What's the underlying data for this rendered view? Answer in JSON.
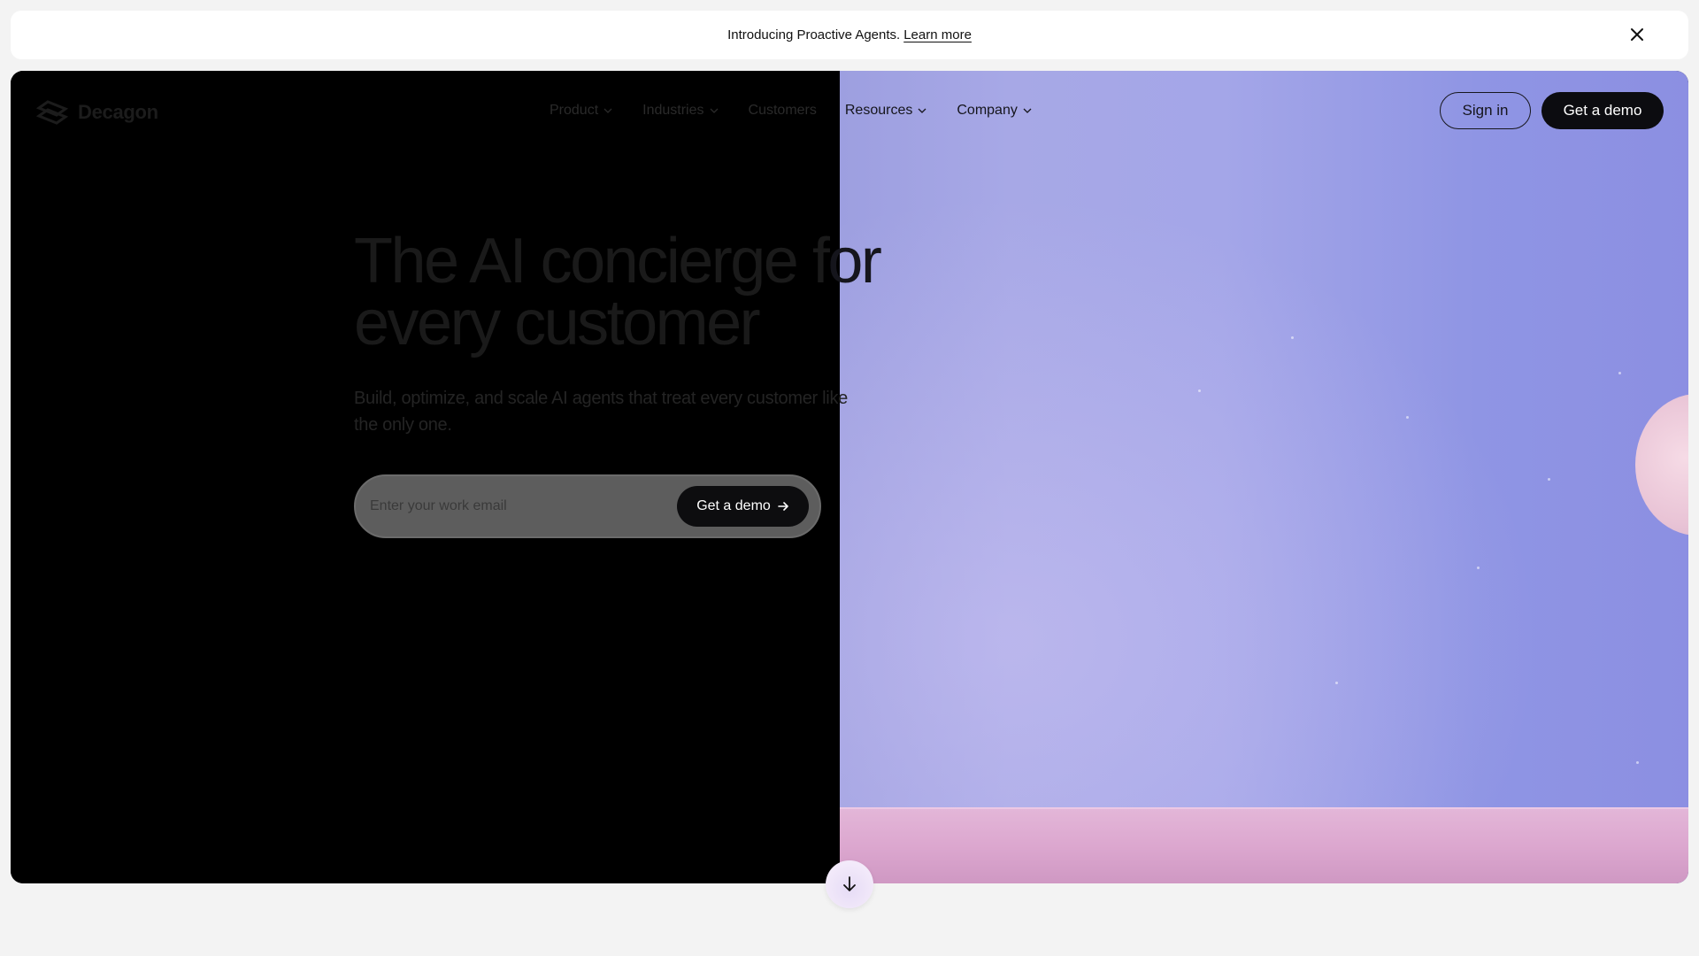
{
  "announcement": {
    "text": "Introducing Proactive Agents.",
    "link_label": "Learn more",
    "close_icon": "close-icon"
  },
  "brand": {
    "name": "Decagon",
    "logo_icon": "decagon-logo-icon"
  },
  "nav": {
    "items": [
      {
        "label": "Product",
        "has_dropdown": true
      },
      {
        "label": "Industries",
        "has_dropdown": true
      },
      {
        "label": "Customers",
        "has_dropdown": false
      },
      {
        "label": "Resources",
        "has_dropdown": true
      },
      {
        "label": "Company",
        "has_dropdown": true
      }
    ],
    "sign_in_label": "Sign in",
    "demo_label": "Get a demo"
  },
  "hero": {
    "headline_line1_dim": "The AI concierge ",
    "headline_line1_split": "f",
    "headline_line1_lit": "or",
    "headline_line2": "every customer",
    "subtitle": "Build, optimize, and scale AI agents that treat every customer like the only one.",
    "email_placeholder": "Enter your work email",
    "cta_label": "Get a demo",
    "cta_icon": "arrow-right-icon",
    "scroll_icon": "arrow-down-icon"
  },
  "colors": {
    "page_bg": "#f3f3f3",
    "hero_dark": "#000000",
    "photo_purple": "#a4a6e8",
    "photo_floor_pink": "#dca7cf",
    "button_dark": "#0c0c10"
  }
}
